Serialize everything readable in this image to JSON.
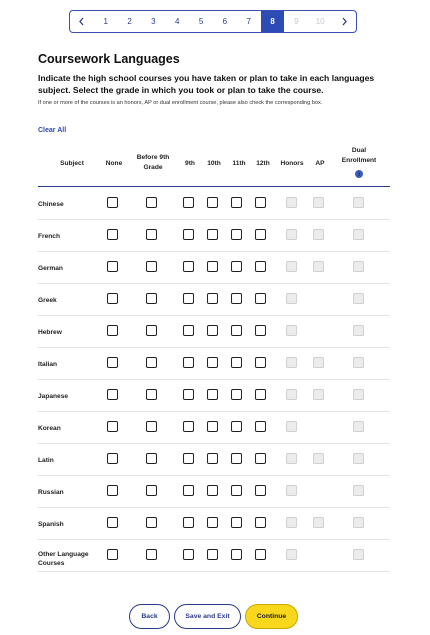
{
  "pagination": {
    "prev_icon": "chevron-left-icon",
    "next_icon": "chevron-right-icon",
    "pages": [
      {
        "label": "1",
        "state": "normal"
      },
      {
        "label": "2",
        "state": "normal"
      },
      {
        "label": "3",
        "state": "normal"
      },
      {
        "label": "4",
        "state": "normal"
      },
      {
        "label": "5",
        "state": "normal"
      },
      {
        "label": "6",
        "state": "normal"
      },
      {
        "label": "7",
        "state": "normal"
      },
      {
        "label": "8",
        "state": "active"
      },
      {
        "label": "9",
        "state": "disabled"
      },
      {
        "label": "10",
        "state": "disabled"
      }
    ]
  },
  "page": {
    "title": "Coursework Languages",
    "instructions": "Indicate the high school courses you have taken or plan to take in each languages subject. Select the grade in which you took or plan to take the course.",
    "note": "If one or more of the courses is an honors, AP or dual enrollment course, please also check the corresponding box.",
    "clear_all": "Clear All"
  },
  "table": {
    "headers": {
      "subject": "Subject",
      "none": "None",
      "before9": "Before 9th Grade",
      "g9": "9th",
      "g10": "10th",
      "g11": "11th",
      "g12": "12th",
      "honors": "Honors",
      "ap": "AP",
      "dual": "Dual Enrollment",
      "dual_info_icon": "info-icon",
      "dual_info_glyph": "i"
    },
    "rows": [
      {
        "subject": "Chinese",
        "ap_available": true
      },
      {
        "subject": "French",
        "ap_available": true
      },
      {
        "subject": "German",
        "ap_available": true
      },
      {
        "subject": "Greek",
        "ap_available": false
      },
      {
        "subject": "Hebrew",
        "ap_available": false
      },
      {
        "subject": "Italian",
        "ap_available": true
      },
      {
        "subject": "Japanese",
        "ap_available": true
      },
      {
        "subject": "Korean",
        "ap_available": false
      },
      {
        "subject": "Latin",
        "ap_available": true
      },
      {
        "subject": "Russian",
        "ap_available": false
      },
      {
        "subject": "Spanish",
        "ap_available": true
      },
      {
        "subject": "Other Language Courses",
        "ap_available": false
      }
    ]
  },
  "footer": {
    "back": "Back",
    "save_exit": "Save and Exit",
    "continue": "Continue"
  },
  "colors": {
    "accent": "#2d4bb5",
    "continue_bg": "#f9d71c"
  }
}
